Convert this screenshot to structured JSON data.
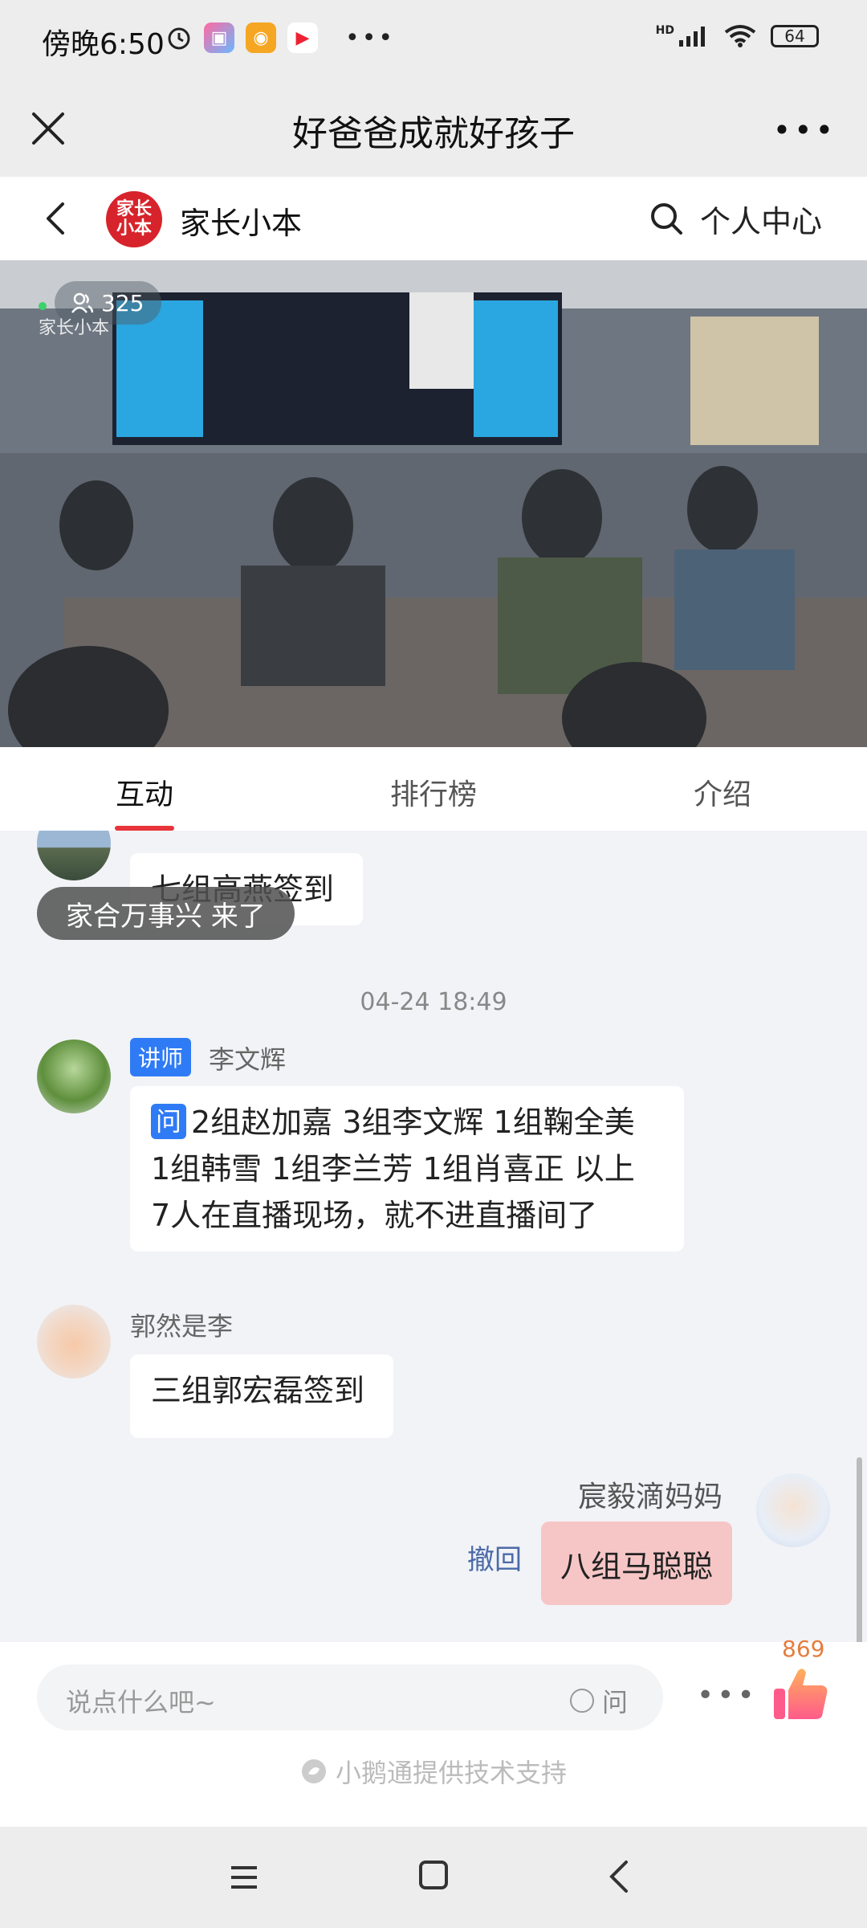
{
  "status_bar": {
    "time": "傍晚6:50",
    "network": "HD",
    "battery": "64"
  },
  "header": {
    "title": "好爸爸成就好孩子"
  },
  "nav": {
    "logo_text": "家长小本",
    "account_name": "家长小本",
    "personal_center": "个人中心"
  },
  "video": {
    "viewer_count": "325",
    "watermark": "家长小本"
  },
  "tabs": [
    {
      "label": "互动",
      "active": true
    },
    {
      "label": "排行榜",
      "active": false
    },
    {
      "label": "介绍",
      "active": false
    }
  ],
  "chat": {
    "toast": "家合万事兴 来了",
    "messages": [
      {
        "name": "",
        "text": "七组高燕签到"
      },
      {
        "timestamp": "04-24 18:49"
      },
      {
        "role_tag": "讲师",
        "name": "李文辉",
        "question_tag": "问",
        "text": "2组赵加嘉 3组李文辉 1组鞠全美 1组韩雪 1组李兰芳 1组肖喜正 以上 7人在直播现场，就不进直播间了"
      },
      {
        "name": "郭然是李",
        "text": "三组郭宏磊签到"
      },
      {
        "name": "宸毅滴妈妈",
        "text": "八组马聪聪",
        "recall_label": "撤回",
        "mine": true
      }
    ]
  },
  "input_bar": {
    "placeholder": "说点什么吧~",
    "question_toggle": "问",
    "like_count": "869",
    "support_text": "小鹅通提供技术支持"
  },
  "colors": {
    "accent": "#e8343a",
    "teacher_tag": "#2f7bf5",
    "my_bubble": "#f6c6c6",
    "like": "#ff7a59"
  }
}
